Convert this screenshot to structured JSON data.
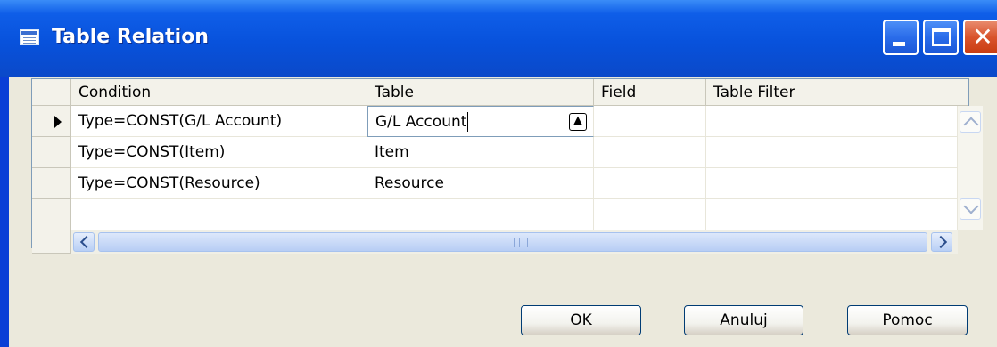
{
  "window": {
    "title": "Table Relation",
    "icon": "table-icon",
    "controls": [
      "minimize-icon",
      "maximize-icon",
      "close-icon"
    ]
  },
  "grid": {
    "columns": [
      "Condition",
      "Table",
      "Field",
      "Table Filter"
    ],
    "rows": [
      {
        "condition": "Type=CONST(G/L Account)",
        "table": "G/L Account",
        "field": "",
        "table_filter": "",
        "current": true
      },
      {
        "condition": "Type=CONST(Item)",
        "table": "Item",
        "field": "",
        "table_filter": "",
        "current": false
      },
      {
        "condition": "Type=CONST(Resource)",
        "table": "Resource",
        "field": "",
        "table_filter": "",
        "current": false
      },
      {
        "condition": "",
        "table": "",
        "field": "",
        "table_filter": "",
        "current": false
      }
    ]
  },
  "buttons": {
    "ok": "OK",
    "cancel": "Anuluj",
    "help": "Pomoc"
  },
  "colors": {
    "titlebar": "#0852dc",
    "close_button": "#d9532c",
    "dialog_bg": "#ebe9dc"
  }
}
